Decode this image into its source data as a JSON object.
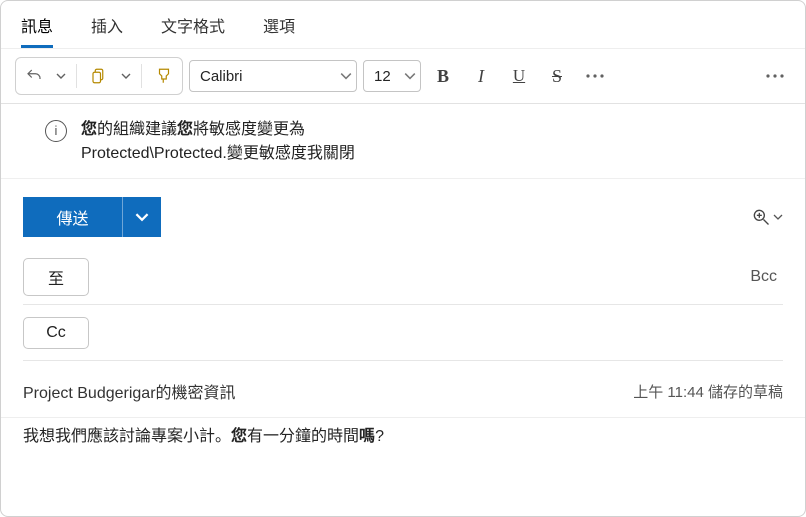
{
  "tabs": {
    "message": "訊息",
    "insert": "插入",
    "text_format": "文字格式",
    "options": "選項"
  },
  "toolbar": {
    "font_name": "Calibri",
    "font_size": "12"
  },
  "infobar": {
    "seg1_bold1": "您",
    "seg1_plain": "的組織建議",
    "seg1_bold2": "您",
    "seg1_tail": "將敏感度變更為",
    "line2": "Protected\\Protected.變更敏感度我關閉"
  },
  "send": {
    "label": "傳送"
  },
  "recipients": {
    "to_label": "至",
    "cc_label": "Cc",
    "bcc_label": "Bcc"
  },
  "subject": {
    "text": "Project Budgerigar的機密資訊",
    "meta": "上午 11:44 儲存的草稿"
  },
  "body": {
    "part1": "我想我們應該討論專案小計。",
    "bold1": "您",
    "mid": "有一分鐘的時間",
    "bold2": "嗎",
    "tail": "?"
  }
}
